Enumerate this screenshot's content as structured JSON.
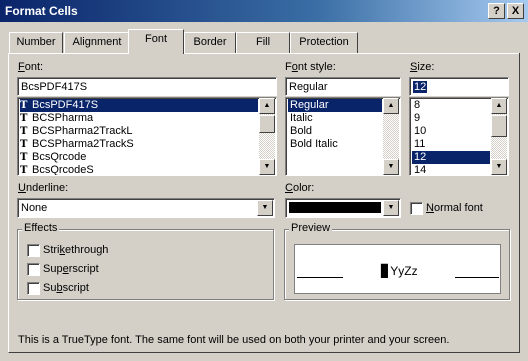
{
  "window": {
    "title": "Format Cells",
    "help_label": "?",
    "close_label": "X"
  },
  "tabs": [
    "Number",
    "Alignment",
    "Font",
    "Border",
    "Fill",
    "Protection"
  ],
  "font": {
    "label": "Font:",
    "value": "BcsPDF417S",
    "items": [
      "BcsPDF417S",
      "BCSPharma",
      "BCSPharma2TrackL",
      "BCSPharma2TrackS",
      "BcsQrcode",
      "BcsQrcodeS"
    ],
    "selected_index": 0
  },
  "font_style": {
    "label": "Font style:",
    "value": "Regular",
    "items": [
      "Regular",
      "Italic",
      "Bold",
      "Bold Italic"
    ],
    "selected_index": 0
  },
  "size": {
    "label": "Size:",
    "value": "12",
    "items": [
      "8",
      "9",
      "10",
      "11",
      "12",
      "14"
    ],
    "selected_index": 4
  },
  "underline": {
    "label": "Underline:",
    "value": "None"
  },
  "color": {
    "label": "Color:",
    "value": "#000000"
  },
  "normal_font": {
    "label": "Normal font"
  },
  "effects": {
    "title": "Effects",
    "items": [
      "Strikethrough",
      "Superscript",
      "Subscript"
    ]
  },
  "preview": {
    "title": "Preview",
    "sample": "▊YyZz"
  },
  "info_text": "This is a TrueType font.  The same font will be used on both your printer and your screen.",
  "icons": {
    "truetype": "TT",
    "arrow_up": "▲",
    "arrow_down": "▼"
  }
}
